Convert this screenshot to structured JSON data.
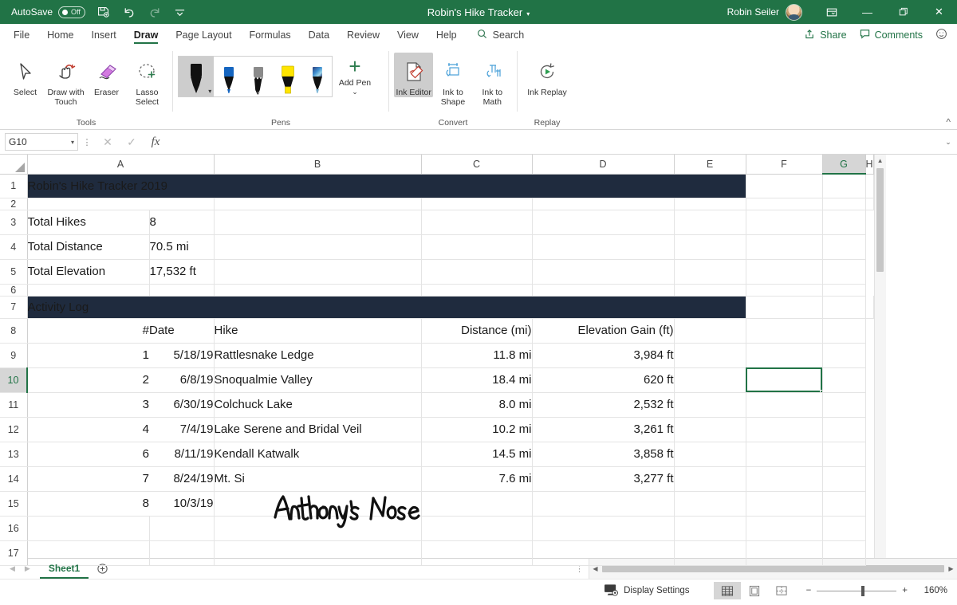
{
  "titlebar": {
    "autosave_label": "AutoSave",
    "autosave_state": "Off",
    "save_icon": "save-icon",
    "undo_icon": "undo-icon",
    "redo_icon": "redo-icon",
    "customize_icon": "customize-quick-access-icon",
    "document_title": "Robin's Hike Tracker",
    "title_caret": "▾",
    "user_name": "Robin Seiler",
    "ribbon_display_icon": "ribbon-display-options-icon",
    "minimize": "—",
    "restore": "❐",
    "close": "✕",
    "accent_color": "#217346"
  },
  "tabs": {
    "items": [
      {
        "label": "File",
        "active": false
      },
      {
        "label": "Home",
        "active": false
      },
      {
        "label": "Insert",
        "active": false
      },
      {
        "label": "Draw",
        "active": true
      },
      {
        "label": "Page Layout",
        "active": false
      },
      {
        "label": "Formulas",
        "active": false
      },
      {
        "label": "Data",
        "active": false
      },
      {
        "label": "Review",
        "active": false
      },
      {
        "label": "View",
        "active": false
      },
      {
        "label": "Help",
        "active": false
      }
    ],
    "search_label": "Search",
    "share_label": "Share",
    "comments_label": "Comments",
    "feedback_icon": "smiley-feedback-icon"
  },
  "ribbon": {
    "groups": [
      {
        "name": "Tools",
        "label": "Tools",
        "buttons": [
          {
            "label": "Select",
            "icon": "cursor-arrow-icon",
            "selected": false
          },
          {
            "label": "Draw with Touch",
            "icon": "draw-with-touch-icon",
            "selected": false
          },
          {
            "label": "Eraser",
            "icon": "eraser-icon",
            "selected": false
          },
          {
            "label": "Lasso Select",
            "icon": "lasso-select-icon",
            "selected": false
          }
        ]
      },
      {
        "name": "Pens",
        "label": "Pens",
        "pens": [
          {
            "name": "black-pen",
            "color": "#111111",
            "selected": true
          },
          {
            "name": "blue-pen",
            "color": "#1565c0",
            "selected": false
          },
          {
            "name": "gray-pencil",
            "color": "#8a8a8a",
            "selected": false
          },
          {
            "name": "yellow-highlighter",
            "color": "#ffe500",
            "selected": false
          },
          {
            "name": "galaxy-pen",
            "color": "#3f6fb5",
            "selected": false
          }
        ],
        "add_pen_label": "Add Pen",
        "add_pen_caret": "⌄"
      },
      {
        "name": "Convert",
        "label": "Convert",
        "buttons": [
          {
            "label": "Ink Editor",
            "icon": "ink-editor-icon",
            "selected": true
          },
          {
            "label": "Ink to Shape",
            "icon": "ink-to-shape-icon",
            "selected": false
          },
          {
            "label": "Ink to Math",
            "icon": "ink-to-math-icon",
            "selected": false
          }
        ]
      },
      {
        "name": "Replay",
        "label": "Replay",
        "buttons": [
          {
            "label": "Ink Replay",
            "icon": "ink-replay-icon",
            "selected": false
          }
        ]
      }
    ],
    "collapse_icon": "collapse-ribbon-chevron-icon"
  },
  "formula_bar": {
    "name_box_value": "G10",
    "name_box_caret": "▾",
    "cancel_icon": "cancel-x-icon",
    "enter_icon": "enter-check-icon",
    "function_icon": "insert-function-fx-icon",
    "formula_value": "",
    "expand_caret": "⌄"
  },
  "grid": {
    "columns": [
      "A",
      "B",
      "C",
      "D",
      "E",
      "F",
      "G",
      "H"
    ],
    "selected_column": "G",
    "selected_cell": "G10",
    "rows": [
      {
        "num": "1",
        "type": "banner",
        "text": "Robin's Hike Tracker 2019"
      },
      {
        "num": "2",
        "type": "blank"
      },
      {
        "num": "3",
        "type": "summary",
        "label": "Total Hikes",
        "value": "8"
      },
      {
        "num": "4",
        "type": "summary",
        "label": "Total Distance",
        "value": "70.5 mi"
      },
      {
        "num": "5",
        "type": "summary",
        "label": "Total Elevation",
        "value": "17,532 ft"
      },
      {
        "num": "6",
        "type": "blank"
      },
      {
        "num": "7",
        "type": "banner",
        "text": "Activity Log"
      },
      {
        "num": "8",
        "type": "header",
        "num_col": "#",
        "date": "Date",
        "hike": "Hike",
        "distance": "Distance (mi)",
        "elevation": "Elevation Gain (ft)"
      },
      {
        "num": "9",
        "type": "data",
        "num_col": "1",
        "date": "5/18/19",
        "hike": "Rattlesnake Ledge",
        "distance": "11.8 mi",
        "elevation": "3,984 ft"
      },
      {
        "num": "10",
        "type": "data",
        "num_col": "2",
        "date": "6/8/19",
        "hike": "Snoqualmie Valley",
        "distance": "18.4 mi",
        "elevation": "620 ft"
      },
      {
        "num": "11",
        "type": "data",
        "num_col": "3",
        "date": "6/30/19",
        "hike": "Colchuck Lake",
        "distance": "8.0 mi",
        "elevation": "2,532 ft"
      },
      {
        "num": "12",
        "type": "data",
        "num_col": "4",
        "date": "7/4/19",
        "hike": "Lake Serene and Bridal Veil",
        "distance": "10.2 mi",
        "elevation": "3,261 ft"
      },
      {
        "num": "13",
        "type": "data",
        "num_col": "6",
        "date": "8/11/19",
        "hike": "Kendall Katwalk",
        "distance": "14.5 mi",
        "elevation": "3,858 ft"
      },
      {
        "num": "14",
        "type": "data",
        "num_col": "7",
        "date": "8/24/19",
        "hike": "Mt. Si",
        "distance": "7.6 mi",
        "elevation": "3,277 ft"
      },
      {
        "num": "15",
        "type": "ink",
        "num_col": "8",
        "date": "10/3/19",
        "hike": "Anthony's Nose",
        "distance": "",
        "elevation": ""
      },
      {
        "num": "16",
        "type": "blank"
      },
      {
        "num": "17",
        "type": "blank"
      }
    ],
    "banner_color": "#1f2b3e",
    "selection_color": "#217346",
    "ink_text": "Anthony's Nose"
  },
  "sheet_bar": {
    "prev_icon": "nav-previous-icon",
    "next_icon": "nav-next-icon",
    "sheets": [
      {
        "label": "Sheet1",
        "active": true
      }
    ],
    "add_sheet_icon": "add-sheet-plus-icon"
  },
  "status_bar": {
    "display_settings_label": "Display Settings",
    "display_settings_icon": "display-settings-monitor-icon",
    "views": [
      {
        "name": "normal-view",
        "icon": "normal-view-icon",
        "active": true
      },
      {
        "name": "page-layout-view",
        "icon": "page-layout-view-icon",
        "active": false
      },
      {
        "name": "page-break-preview",
        "icon": "page-break-preview-icon",
        "active": false
      }
    ],
    "zoom_out": "−",
    "zoom_in": "+",
    "zoom_level": "160%"
  }
}
